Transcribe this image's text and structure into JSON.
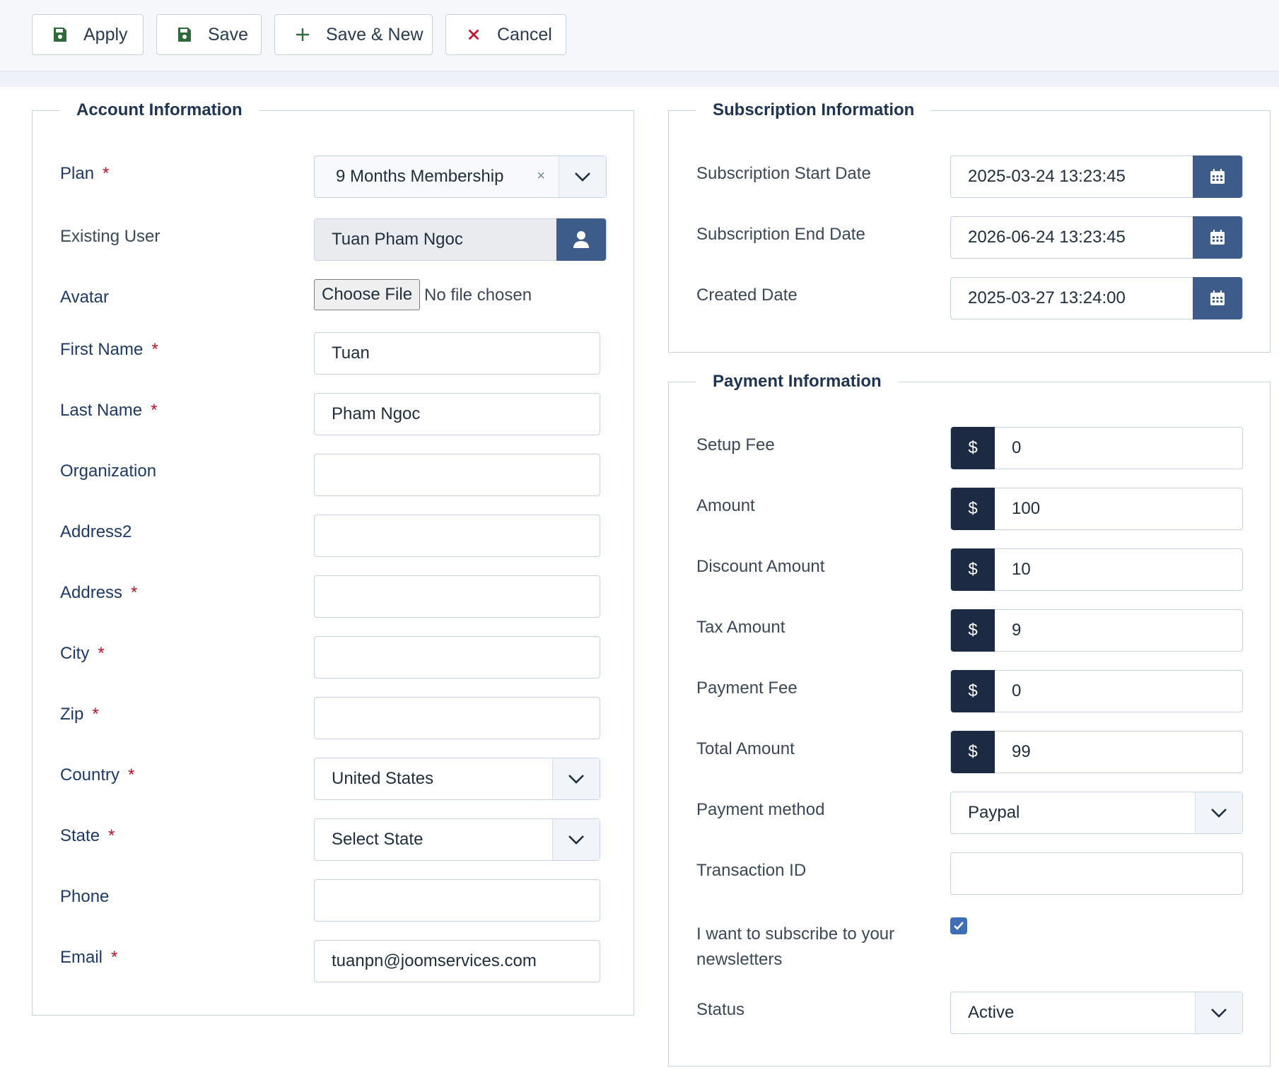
{
  "toolbar": {
    "apply": "Apply",
    "save": "Save",
    "save_new": "Save & New",
    "cancel": "Cancel"
  },
  "account": {
    "legend": "Account Information",
    "plan_label": "Plan",
    "plan_value": "9 Months Membership",
    "existing_user_label": "Existing User",
    "existing_user_value": "Tuan Pham Ngoc",
    "avatar_label": "Avatar",
    "choose_file": "Choose File",
    "no_file": "No file chosen",
    "first_name_label": "First Name",
    "first_name_value": "Tuan",
    "last_name_label": "Last Name",
    "last_name_value": "Pham Ngoc",
    "organization_label": "Organization",
    "organization_value": "",
    "address2_label": "Address2",
    "address2_value": "",
    "address_label": "Address",
    "address_value": "",
    "city_label": "City",
    "city_value": "",
    "zip_label": "Zip",
    "zip_value": "",
    "country_label": "Country",
    "country_value": "United States",
    "state_label": "State",
    "state_value": "Select State",
    "phone_label": "Phone",
    "phone_value": "",
    "email_label": "Email",
    "email_value": "tuanpn@joomservices.com",
    "required_mark": "*"
  },
  "subscription": {
    "legend": "Subscription Information",
    "start_label": "Subscription Start Date",
    "start_value": "2025-03-24 13:23:45",
    "end_label": "Subscription End Date",
    "end_value": "2026-06-24 13:23:45",
    "created_label": "Created Date",
    "created_value": "2025-03-27 13:24:00"
  },
  "payment": {
    "legend": "Payment Information",
    "currency": "$",
    "setup_fee_label": "Setup Fee",
    "setup_fee_value": "0",
    "amount_label": "Amount",
    "amount_value": "100",
    "discount_label": "Discount Amount",
    "discount_value": "10",
    "tax_label": "Tax Amount",
    "tax_value": "9",
    "payment_fee_label": "Payment Fee",
    "payment_fee_value": "0",
    "total_label": "Total Amount",
    "total_value": "99",
    "method_label": "Payment method",
    "method_value": "Paypal",
    "transaction_label": "Transaction ID",
    "transaction_value": "",
    "newsletter_label_line1": "I want to subscribe to your",
    "newsletter_label_line2": "newsletters",
    "newsletter_checked": true,
    "status_label": "Status",
    "status_value": "Active"
  },
  "colors": {
    "accent": "#3e5c8a",
    "addon": "#1c2b43",
    "required": "#c0102a",
    "save_icon": "#2e6b3a",
    "cancel_icon": "#c0102a"
  }
}
